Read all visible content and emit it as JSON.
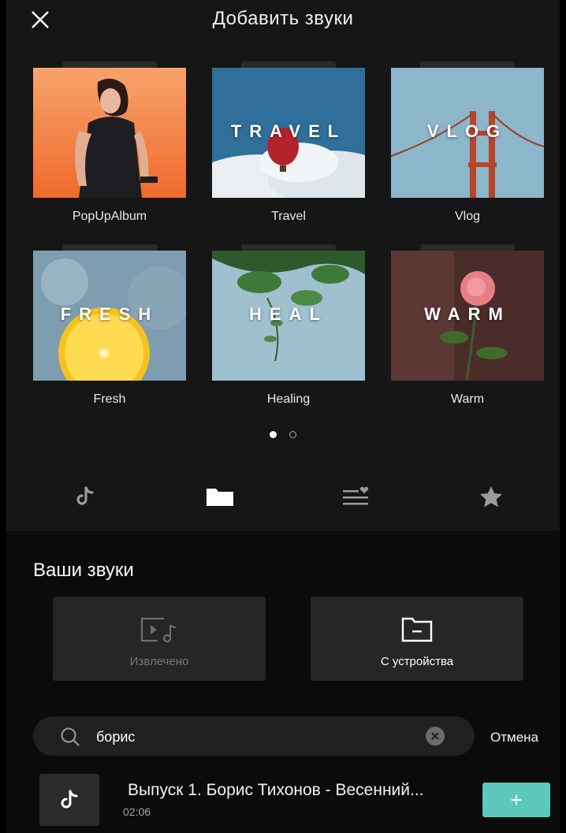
{
  "header": {
    "title": "Добавить звуки",
    "close_icon": "close-icon"
  },
  "albums": [
    {
      "label": "PopUpAlbum",
      "overlay": ""
    },
    {
      "label": "Travel",
      "overlay": "TRAVEL"
    },
    {
      "label": "Vlog",
      "overlay": "VLOG"
    },
    {
      "label": "Fresh",
      "overlay": "FRESH"
    },
    {
      "label": "Healing",
      "overlay": "HEAL"
    },
    {
      "label": "Warm",
      "overlay": "WARM"
    }
  ],
  "pagination": {
    "current": 1,
    "total": 2
  },
  "tabs": [
    {
      "icon": "tiktok-icon",
      "active": false
    },
    {
      "icon": "folder-icon",
      "active": true
    },
    {
      "icon": "playlist-heart-icon",
      "active": false
    },
    {
      "icon": "star-icon",
      "active": false
    }
  ],
  "your_sounds": {
    "title": "Ваши звуки",
    "extracted_label": "Извлечено",
    "device_label": "С устройства"
  },
  "search": {
    "value": "борис",
    "cancel_label": "Отмена"
  },
  "results": [
    {
      "title": "Выпуск 1. Борис Тихонов - Весенний...",
      "duration": "02:06",
      "add_label": "+"
    }
  ],
  "colors": {
    "accent": "#5bc8bb",
    "top_bg": "#161616",
    "bottom_bg": "#0b0b0b"
  }
}
